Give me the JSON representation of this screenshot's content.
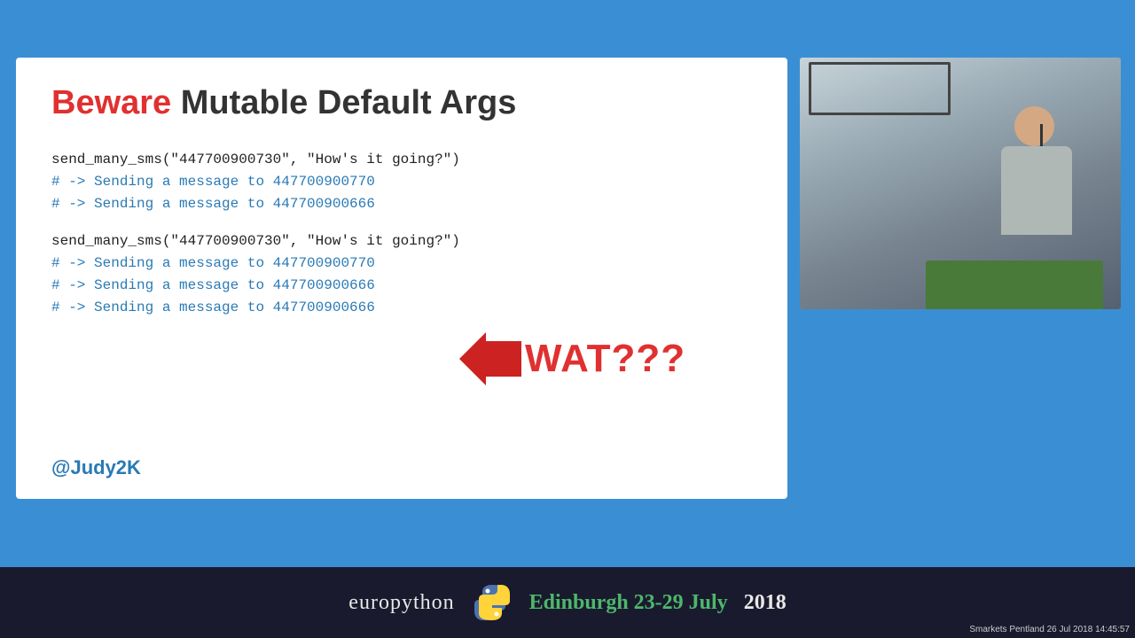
{
  "header": {
    "background": "#3a8fd4"
  },
  "slide": {
    "title_red": "Beware",
    "title_rest": " Mutable Default Args",
    "code_block_1": {
      "line1": "send_many_sms(\"447700900730\", \"How's it going?\")",
      "line2": "# -> Sending a message to 447700900770",
      "line3": "# -> Sending a message to 447700900666"
    },
    "code_block_2": {
      "line1": "send_many_sms(\"447700900730\", \"How's it going?\")",
      "line2": "# -> Sending a message to 447700900770",
      "line3": "# -> Sending a message to 447700900666",
      "line4": "# -> Sending a message to 447700900666"
    },
    "wat_label": "WAT???",
    "twitter": "@Judy2K"
  },
  "footer": {
    "brand": "europython",
    "city_date": "Edinburgh 23-29 July",
    "year": "2018",
    "timestamp": "Smarkets Pentland 26 Jul 2018 14:45:57"
  }
}
